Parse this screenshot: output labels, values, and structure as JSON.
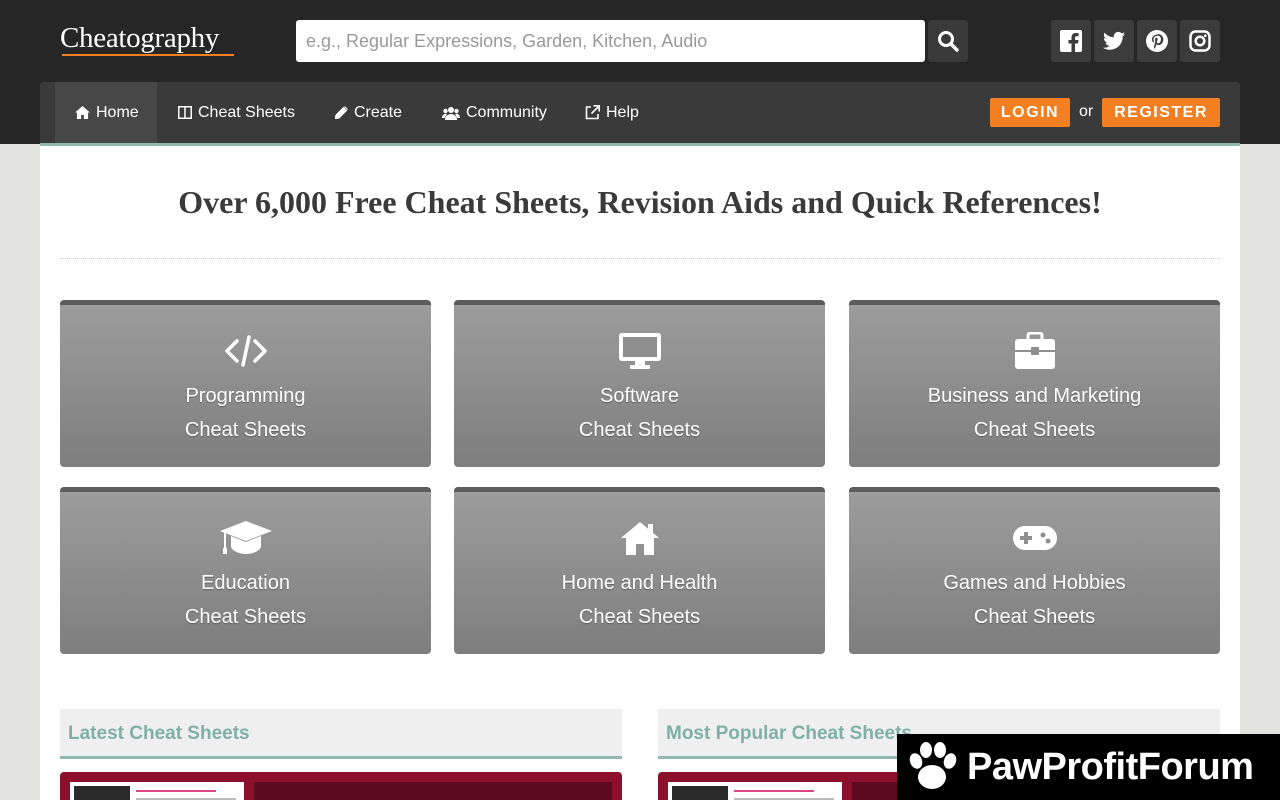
{
  "header": {
    "logo_text": "Cheatography",
    "search": {
      "placeholder": "e.g., Regular Expressions, Garden, Kitchen, Audio",
      "value": ""
    },
    "social": [
      "facebook-icon",
      "twitter-icon",
      "pinterest-icon",
      "instagram-icon"
    ]
  },
  "nav": {
    "items": [
      {
        "label": "Home",
        "icon": "home-icon",
        "active": true
      },
      {
        "label": "Cheat Sheets",
        "icon": "columns-icon"
      },
      {
        "label": "Create",
        "icon": "pencil-icon"
      },
      {
        "label": "Community",
        "icon": "users-icon"
      },
      {
        "label": "Help",
        "icon": "external-link-icon"
      }
    ],
    "login_label": "LOGIN",
    "or_label": "or",
    "register_label": "REGISTER"
  },
  "main": {
    "headline": "Over 6,000 Free Cheat Sheets, Revision Aids and Quick References!",
    "categories": [
      {
        "title": "Programming",
        "sub": "Cheat Sheets",
        "icon": "code-icon"
      },
      {
        "title": "Software",
        "sub": "Cheat Sheets",
        "icon": "monitor-icon"
      },
      {
        "title": "Business and Marketing",
        "sub": "Cheat Sheets",
        "icon": "briefcase-icon"
      },
      {
        "title": "Education",
        "sub": "Cheat Sheets",
        "icon": "graduation-cap-icon"
      },
      {
        "title": "Home and Health",
        "sub": "Cheat Sheets",
        "icon": "house-icon"
      },
      {
        "title": "Games and Hobbies",
        "sub": "Cheat Sheets",
        "icon": "gamepad-icon"
      }
    ],
    "sections": [
      {
        "title": "Latest Cheat Sheets"
      },
      {
        "title": "Most Popular Cheat Sheets"
      }
    ]
  },
  "watermark": {
    "text": "PawProfitForum"
  },
  "colors": {
    "accent": "#f47f20",
    "teal": "#8fb8ae",
    "header_bg": "#262626",
    "tile_bg": "#8c8c8c"
  }
}
